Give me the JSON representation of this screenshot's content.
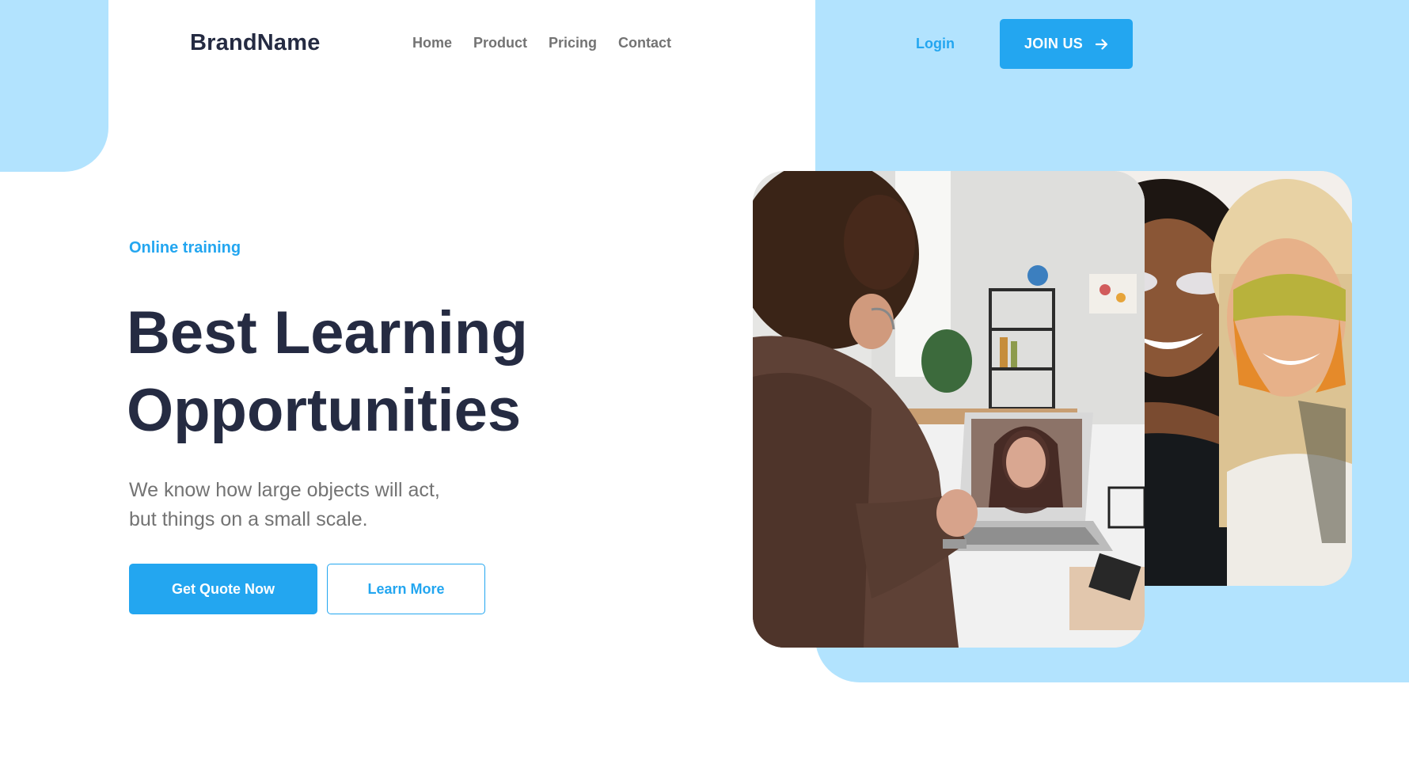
{
  "header": {
    "brand": "BrandName",
    "nav": [
      "Home",
      "Product",
      "Pricing",
      "Contact"
    ],
    "login_label": "Login",
    "join_label": "JOIN US"
  },
  "hero": {
    "eyebrow": "Online training",
    "title_lines": [
      "Best Learning",
      "Opportunities"
    ],
    "description_lines": [
      "We know how large objects will act,",
      "but things on a small scale."
    ],
    "primary_button": "Get Quote Now",
    "secondary_button": "Learn More"
  },
  "images": {
    "main_photo": "student-video-call-photo",
    "side_photo": "two-women-face-mask-photo"
  },
  "colors": {
    "accent": "#23a6f0",
    "light_blue": "#b2e3fe",
    "heading": "#252b42",
    "muted": "#737373"
  },
  "icons": {
    "join_arrow": "arrow-right-icon"
  }
}
